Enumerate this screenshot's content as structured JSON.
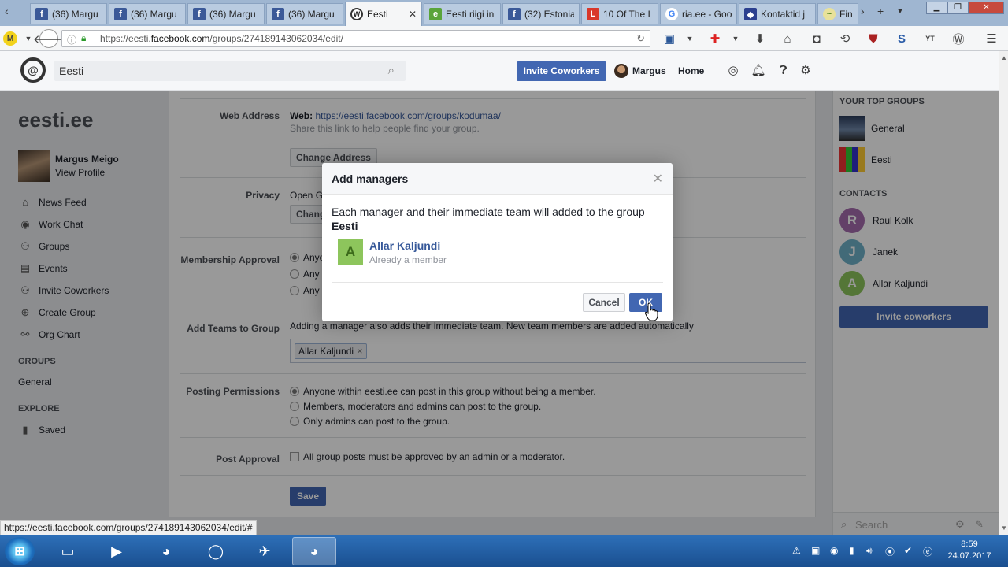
{
  "browser": {
    "tabs": [
      {
        "label": "(36) Margu",
        "favicon": "fb"
      },
      {
        "label": "(36) Margu",
        "favicon": "fb"
      },
      {
        "label": "(36) Margu",
        "favicon": "fb"
      },
      {
        "label": "(36) Margu",
        "favicon": "fb"
      },
      {
        "label": "Eesti",
        "favicon": "wp",
        "active": true
      },
      {
        "label": "Eesti riigi in",
        "favicon": "ee"
      },
      {
        "label": "(32) Estonia",
        "favicon": "fb"
      },
      {
        "label": "10 Of The I",
        "favicon": "lst"
      },
      {
        "label": "ria.ee - Goo",
        "favicon": "gg"
      },
      {
        "label": "Kontaktid j",
        "favicon": "kt"
      },
      {
        "label": "Fini",
        "favicon": "fn"
      }
    ],
    "url_prefix": "https://eesti.",
    "url_domain": "facebook.com",
    "url_path": "/groups/274189143062034/edit/",
    "status_url": "https://eesti.facebook.com/groups/274189143062034/edit/#"
  },
  "header": {
    "search_value": "Eesti",
    "invite_label": "Invite Coworkers",
    "user_name": "Margus",
    "home_label": "Home"
  },
  "left": {
    "group_title": "eesti.ee",
    "profile_name": "Margus Meigo",
    "view_profile": "View Profile",
    "nav": [
      {
        "label": "News Feed",
        "icon": "⌂"
      },
      {
        "label": "Work Chat",
        "icon": "◉"
      },
      {
        "label": "Groups",
        "icon": "⚇"
      },
      {
        "label": "Events",
        "icon": "▤"
      },
      {
        "label": "Invite Coworkers",
        "icon": "⚇"
      },
      {
        "label": "Create Group",
        "icon": "⊕"
      },
      {
        "label": "Org Chart",
        "icon": "⚯"
      }
    ],
    "groups_heading": "GROUPS",
    "groups_item": "General",
    "explore_heading": "EXPLORE",
    "saved_label": "Saved"
  },
  "main": {
    "web_address_label": "Web Address",
    "web_prefix": "Web:",
    "web_link": "https://eesti.facebook.com/groups/kodumaa/",
    "web_hint": "Share this link to help people find your group.",
    "change_address": "Change Address",
    "privacy_label": "Privacy",
    "privacy_value": "Open G",
    "privacy_change": "Chang",
    "membership_label": "Membership Approval",
    "membership_options": [
      "Anyo",
      "Any m",
      "Any m"
    ],
    "add_teams_label": "Add Teams to Group",
    "add_teams_text": "Adding a manager also adds their immediate team. New team members are added automatically",
    "team_token": "Allar Kaljundi",
    "posting_label": "Posting Permissions",
    "posting_options": [
      "Anyone within eesti.ee can post in this group without being a member.",
      "Members, moderators and admins can post to the group.",
      "Only admins can post to the group."
    ],
    "post_approval_label": "Post Approval",
    "post_approval_text": "All group posts must be approved by an admin or a moderator.",
    "save_label": "Save"
  },
  "right": {
    "top_groups_heading": "YOUR TOP GROUPS",
    "top_groups": [
      "General",
      "Eesti"
    ],
    "contacts_heading": "CONTACTS",
    "contacts": [
      {
        "initial": "R",
        "name": "Raul Kolk",
        "color": "#a56bad"
      },
      {
        "initial": "J",
        "name": "Janek",
        "color": "#6fb1c8"
      },
      {
        "initial": "A",
        "name": "Allar Kaljundi",
        "color": "#8dc55c"
      }
    ],
    "invite_label": "Invite coworkers",
    "search_placeholder": "Search"
  },
  "modal": {
    "title": "Add managers",
    "desc": "Each manager and their immediate team will added to the group",
    "group_name": "Eesti",
    "member_initial": "A",
    "member_name": "Allar Kaljundi",
    "member_status": "Already a member",
    "cancel_label": "Cancel",
    "ok_label": "OK"
  },
  "taskbar": {
    "time": "8:59",
    "date": "24.07.2017"
  }
}
